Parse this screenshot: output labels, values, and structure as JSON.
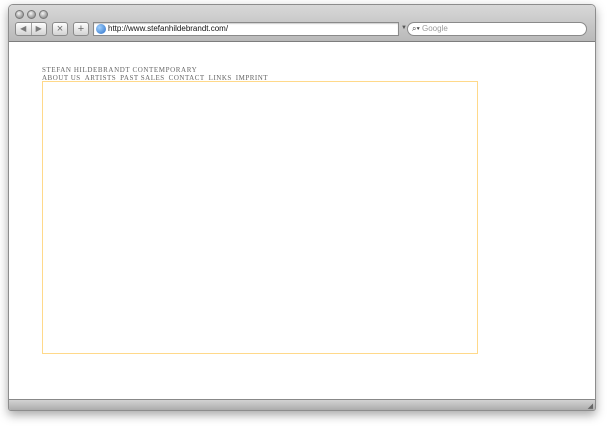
{
  "browser": {
    "url": "http://www.stefanhildebrandt.com/",
    "search_placeholder": "Google",
    "icons": {
      "back": "back-arrow-icon",
      "forward": "forward-arrow-icon",
      "stop": "close-icon",
      "add": "plus-icon",
      "site": "globe-icon",
      "search": "magnifier-icon"
    }
  },
  "site": {
    "title": "STEFAN HILDEBRANDT CONTEMPORARY",
    "nav": [
      "ABOUT US",
      "ARTISTS",
      "PAST SALES",
      "CONTACT",
      "LINKS",
      "IMPRINT"
    ],
    "frame_color": "#ffd98a"
  }
}
